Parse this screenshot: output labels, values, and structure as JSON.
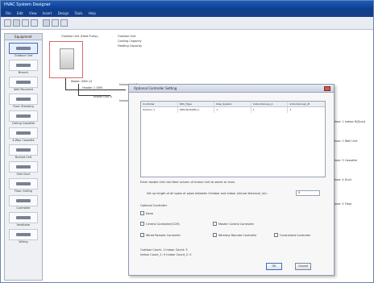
{
  "window": {
    "title": "HVAC System Designer"
  },
  "menu": [
    "File",
    "Edit",
    "View",
    "Insert",
    "Design",
    "Tools",
    "Help"
  ],
  "sidebar": {
    "title": "Equipment",
    "items": [
      {
        "label": "Outdoor Unit"
      },
      {
        "label": "Branch"
      },
      {
        "label": "Wall Mounted"
      },
      {
        "label": "Floor Standing"
      },
      {
        "label": "Ceiling Cassette"
      },
      {
        "label": "4-Way Cassette"
      },
      {
        "label": "Ducted Unit"
      },
      {
        "label": "Slim Duct"
      },
      {
        "label": "Floor Ceiling"
      },
      {
        "label": "Controller"
      },
      {
        "label": "Ventilator"
      },
      {
        "label": "Wiring"
      }
    ]
  },
  "canvas": {
    "unit_label": "Outdoor Unit (Heat Pump)",
    "unit_caption": "Model: GMV-12",
    "spec_lines": [
      "Outdoor Unit",
      "Cooling Capacity",
      "Heating Capacity"
    ],
    "node_labels": [
      "Header 1 GMV",
      "Indoor Unit A",
      "Indoor Unit B",
      "Indoor Unit C"
    ],
    "right_labels": [
      "Indoor: 1 Indoor B(Duct)",
      "Indoor: 2 Wall Unit",
      "Indoor: 3 Cassette",
      "Indoor: 4 Duct",
      "Indoor: 5 Floor"
    ]
  },
  "dialog": {
    "title": "Optional Controller Setting",
    "table": {
      "headers": [
        "Controller",
        "ODU_Type",
        "Disp_System",
        "Indoor(Group)_A",
        "Indoor(Group)_B"
      ],
      "rows": [
        [
          "Outdoor 1",
          "GMV-Multi(HP)-C",
          "1",
          "1",
          "1"
        ]
      ]
    },
    "instruction": "Enter double click the Next column of Indoor Unit to select or clear.",
    "field_label": "Set up length of all types of pipes between Outdoor and Indoor (Actual distance) (m):",
    "field_value": "5",
    "section_label": "Optional Controller",
    "checkboxes": [
      {
        "label": "None"
      },
      {
        "label": "Central Controller(CCM)"
      },
      {
        "label": "Master Control Controller"
      },
      {
        "label": "Wired Remote Controller"
      },
      {
        "label": "Wireless Remote Controller"
      },
      {
        "label": "Centralized Controller"
      }
    ],
    "status_lines": [
      "Outdoor Count: 1   Indoor Count: 5",
      "Indoor Count_1: 0   Indoor Count_2: 0"
    ],
    "ok_label": "OK",
    "cancel_label": "Cancel"
  }
}
